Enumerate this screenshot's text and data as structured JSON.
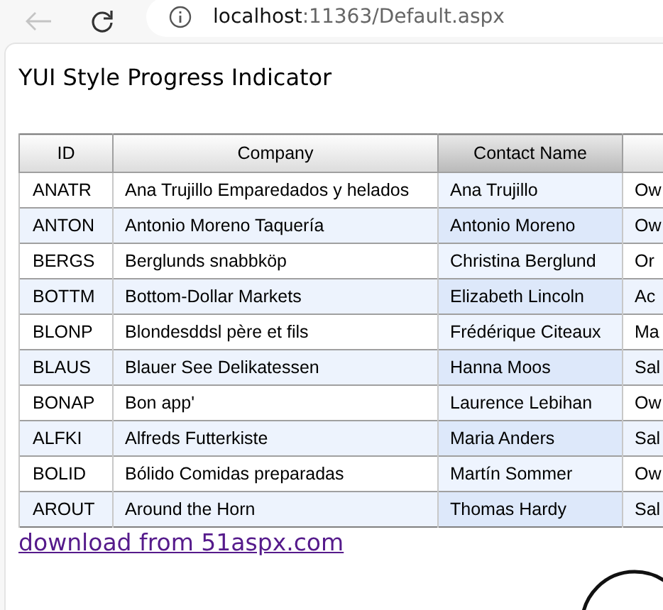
{
  "browser": {
    "back_disabled": true,
    "url_host": "localhost",
    "url_path": ":11363/Default.aspx"
  },
  "page": {
    "title": "YUI Style Progress Indicator"
  },
  "table": {
    "columns": [
      {
        "label": "ID",
        "selected": false
      },
      {
        "label": "Company",
        "selected": false
      },
      {
        "label": "Contact Name",
        "selected": true
      },
      {
        "selected": false
      }
    ],
    "rows": [
      [
        "ANATR",
        "Ana Trujillo Emparedados y helados",
        "Ana Trujillo",
        "Ow"
      ],
      [
        "ANTON",
        "Antonio Moreno Taquería",
        "Antonio Moreno",
        "Ow"
      ],
      [
        "BERGS",
        "Berglunds snabbköp",
        "Christina Berglund",
        "Or"
      ],
      [
        "BOTTM",
        "Bottom-Dollar Markets",
        "Elizabeth Lincoln",
        "Ac"
      ],
      [
        "BLONP",
        "Blondesddsl père et fils",
        "Frédérique Citeaux",
        "Ma"
      ],
      [
        "BLAUS",
        "Blauer See Delikatessen",
        "Hanna Moos",
        "Sal"
      ],
      [
        "BONAP",
        "Bon app'",
        "Laurence Lebihan",
        "Ow"
      ],
      [
        "ALFKI",
        "Alfreds Futterkiste",
        "Maria Anders",
        "Sal"
      ],
      [
        "BOLID",
        "Bólido Comidas preparadas",
        "Martín Sommer",
        "Ow"
      ],
      [
        "AROUT",
        "Around the Horn",
        "Thomas Hardy",
        "Sal"
      ]
    ]
  },
  "link": "download from 51aspx.com"
}
